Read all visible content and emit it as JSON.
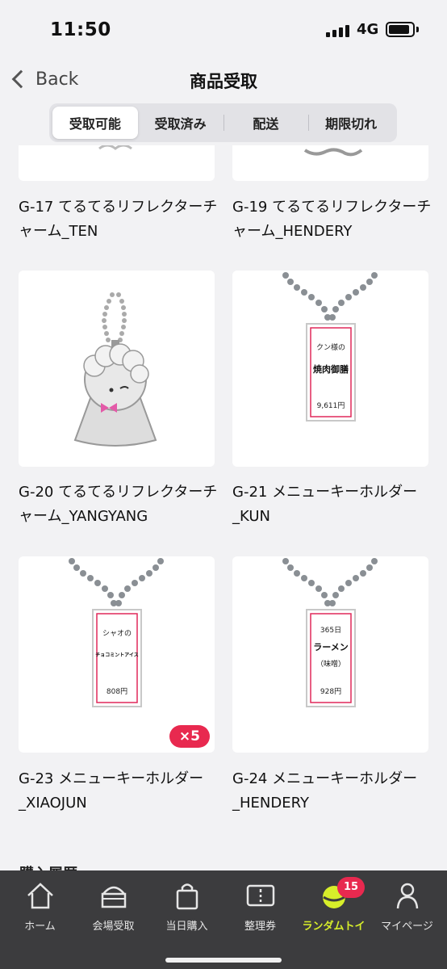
{
  "status_bar": {
    "time": "11:50",
    "network": "4G"
  },
  "header": {
    "back_label": "Back",
    "title": "商品受取"
  },
  "segments": [
    "受取可能",
    "受取済み",
    "配送",
    "期限切れ"
  ],
  "items": [
    {
      "name": "G-17 てるてるリフレクターチャーム_TEN"
    },
    {
      "name": "G-19 てるてるリフレクターチャーム_HENDERY"
    },
    {
      "name": "G-20 てるてるリフレクターチャーム_YANGYANG"
    },
    {
      "name": "G-21 メニューキーホルダー_KUN",
      "tag_lines": [
        "クン様の",
        "焼肉御膳"
      ],
      "price": "9,611円"
    },
    {
      "name": "G-23 メニューキーホルダー_XIAOJUN",
      "tag_lines": [
        "シャオの",
        "チョコミントアイス"
      ],
      "price": "808円",
      "quantity": "×5"
    },
    {
      "name": "G-24 メニューキーホルダー_HENDERY",
      "tag_lines": [
        "365日",
        "ラーメン",
        "（味噌）"
      ],
      "price": "928円"
    }
  ],
  "section_peek": "購入履歴",
  "tabbar": {
    "items": [
      {
        "label": "ホーム",
        "icon": "home-icon"
      },
      {
        "label": "会場受取",
        "icon": "store-icon"
      },
      {
        "label": "当日購入",
        "icon": "bag-icon"
      },
      {
        "label": "整理券",
        "icon": "ticket-icon"
      },
      {
        "label": "ランダムトイ",
        "icon": "random-toy-icon",
        "badge": "15"
      },
      {
        "label": "マイページ",
        "icon": "person-icon"
      }
    ]
  },
  "colors": {
    "accent": "#d7ee2a",
    "badge": "#e8294f",
    "tabbar_bg": "#3c3c3e",
    "bg": "#f2f2f4"
  }
}
